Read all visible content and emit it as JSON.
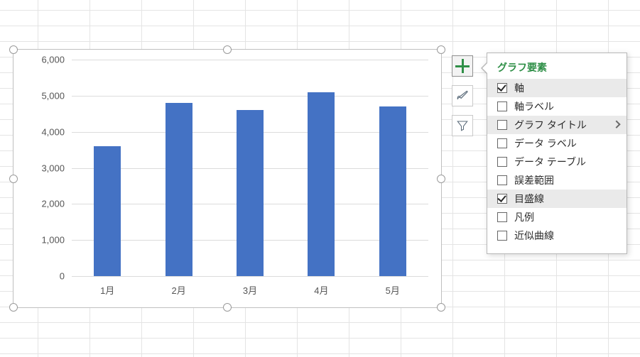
{
  "chart_data": {
    "type": "bar",
    "categories": [
      "1月",
      "2月",
      "3月",
      "4月",
      "5月"
    ],
    "values": [
      3600,
      4800,
      4600,
      5100,
      4700
    ],
    "title": "",
    "xlabel": "",
    "ylabel": "",
    "ylim": [
      0,
      6000
    ],
    "ytick_step": 1000,
    "yticks": [
      "0",
      "1,000",
      "2,000",
      "3,000",
      "4,000",
      "5,000",
      "6,000"
    ],
    "bar_color": "#4472c4",
    "grid_color": "#dcdcdc"
  },
  "side_buttons": {
    "add": {
      "name": "chart-elements",
      "active": true
    },
    "style": {
      "name": "chart-styles",
      "active": false
    },
    "filter": {
      "name": "chart-filter",
      "active": false
    }
  },
  "popover": {
    "title": "グラフ要素",
    "items": [
      {
        "label": "軸",
        "checked": true,
        "hover": true,
        "submenu": false
      },
      {
        "label": "軸ラベル",
        "checked": false,
        "hover": false,
        "submenu": false
      },
      {
        "label": "グラフ タイトル",
        "checked": false,
        "hover": true,
        "submenu": true
      },
      {
        "label": "データ ラベル",
        "checked": false,
        "hover": false,
        "submenu": false
      },
      {
        "label": "データ テーブル",
        "checked": false,
        "hover": false,
        "submenu": false
      },
      {
        "label": "誤差範囲",
        "checked": false,
        "hover": false,
        "submenu": false
      },
      {
        "label": "目盛線",
        "checked": true,
        "hover": true,
        "submenu": false
      },
      {
        "label": "凡例",
        "checked": false,
        "hover": false,
        "submenu": false
      },
      {
        "label": "近似曲線",
        "checked": false,
        "hover": false,
        "submenu": false
      }
    ]
  }
}
